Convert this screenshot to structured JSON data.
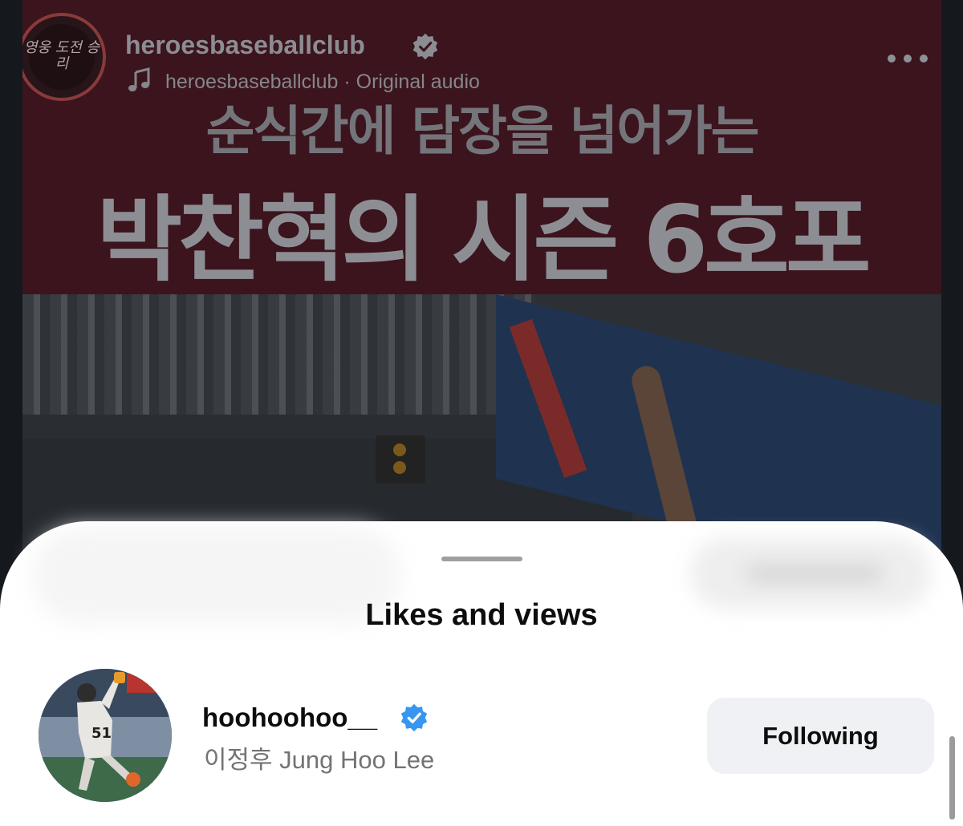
{
  "background_post": {
    "account_name": "heroesbaseballclub",
    "audio_label": "heroesbaseballclub · Original audio",
    "headline_line1": "순식간에 담장을 넘어가는",
    "headline_line2": "박찬혁의 시즌 6호포",
    "avatar_text": "영웅 도전 승리"
  },
  "sheet": {
    "title": "Likes and views",
    "user": {
      "username": "hoohoohoo__",
      "full_name": "이정후 Jung Hoo Lee",
      "verified": true,
      "follow_button_label": "Following"
    }
  },
  "colors": {
    "verified_badge": "#3797f0",
    "title_band": "#3b141d",
    "button_bg": "#eff1f4"
  }
}
